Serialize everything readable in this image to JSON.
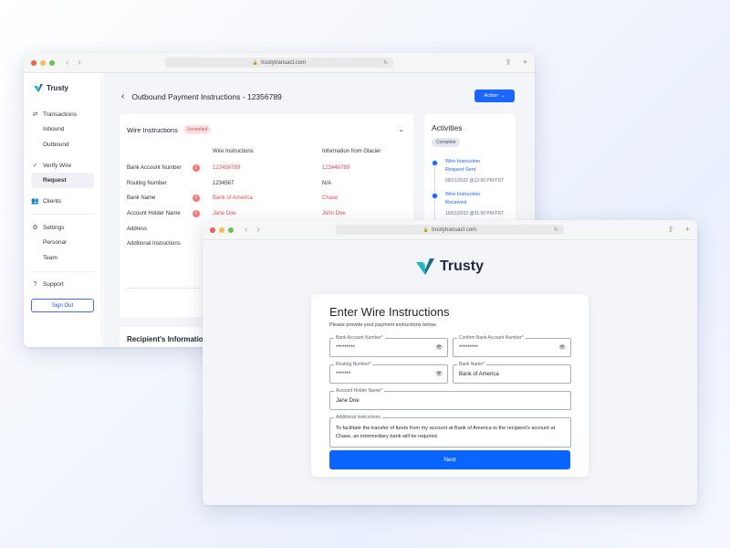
{
  "back_window": {
    "url": "trustytransact.com",
    "logo": "Trusty",
    "sidebar": {
      "transactions": "Transactions",
      "inbound": "Inbound",
      "outbound": "Outbound",
      "verify_wire": "Verify Wire",
      "request": "Request",
      "clients": "Clients",
      "settings": "Settings",
      "personal": "Personal",
      "team": "Team",
      "support": "Support",
      "sign_out": "Sign Out"
    },
    "page_title": "Outbound Payment Instructions - 12356789",
    "action_label": "Action",
    "wire_card": {
      "title": "Wire Instructions",
      "badge": "Unverified",
      "col_wire": "Wire Instructions",
      "col_glacier": "Information from Glacier",
      "rows": [
        {
          "label": "Bank Account Number",
          "wire": "123456789",
          "glacier": "123446789",
          "mismatch": true
        },
        {
          "label": "Routing Number",
          "wire": "1234567",
          "glacier": "N/A",
          "mismatch": false
        },
        {
          "label": "Bank Name",
          "wire": "Bank of America",
          "glacier": "Chase",
          "mismatch": true
        },
        {
          "label": "Account Holder Name",
          "wire": "Jane Doe",
          "glacier": "John Doe",
          "mismatch": true
        },
        {
          "label": "Address",
          "wire": "",
          "glacier": "",
          "mismatch": false
        },
        {
          "label": "Additional Instructions",
          "wire": "",
          "glacier": "",
          "mismatch": false
        }
      ]
    },
    "recipient_title": "Recipient's Informatio",
    "activities": {
      "title": "Activities",
      "badge": "Complete",
      "items": [
        {
          "line1": "Wire Instruction",
          "line2": "Request Sent",
          "time": "09/21/2022 @12:00 PM PST"
        },
        {
          "line1": "Wire Instruction",
          "line2": "Received",
          "time": "10/01/2022 @01:00 PM PST"
        }
      ]
    }
  },
  "front_window": {
    "url": "trustytransact.com",
    "logo": "Trusty",
    "form": {
      "title": "Enter Wire Instructions",
      "subtitle": "Please provide your payment instructions below.",
      "fields": {
        "bank_account": {
          "label": "Bank Account Number*",
          "value": "*********"
        },
        "confirm_account": {
          "label": "Confirm Bank Account Number*",
          "value": "*********"
        },
        "routing": {
          "label": "Routing Number*",
          "value": "*******"
        },
        "bank_name": {
          "label": "Bank Name*",
          "value": "Bank of America"
        },
        "holder": {
          "label": "Account Holder Name*",
          "value": "Jane Doe"
        },
        "additional": {
          "label": "Additional Instructions",
          "value": "To facilitate the transfer of funds from my account at Bank of America to the recipient's account at Chase, an intermediary bank will be required."
        }
      },
      "next_label": "Next"
    }
  },
  "colors": {
    "brand_blue": "#1a66ff",
    "warning_red": "#e14a52",
    "logo_teal": "#1fb5c9"
  }
}
